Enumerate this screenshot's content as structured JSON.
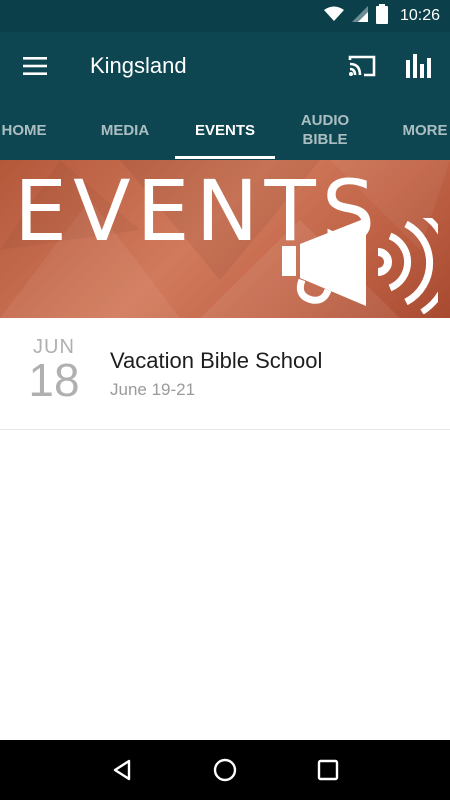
{
  "status_bar": {
    "time": "10:26",
    "icons": [
      "wifi-icon",
      "signal-icon",
      "battery-icon"
    ]
  },
  "app_bar": {
    "title": "Kingsland",
    "icons": [
      "menu-icon",
      "cast-icon",
      "stats-icon"
    ]
  },
  "tabs": [
    {
      "label": "HOME"
    },
    {
      "label": "MEDIA"
    },
    {
      "label": "EVENTS"
    },
    {
      "label": "AUDIO BIBLE"
    },
    {
      "label": "MORE"
    }
  ],
  "active_tab": "EVENTS",
  "banner": {
    "title": "EVENTS",
    "icon": "megaphone-icon"
  },
  "events": [
    {
      "month": "JUN",
      "day": "18",
      "title": "Vacation Bible School",
      "dates": "June 19-21"
    }
  ],
  "nav_bar": {
    "icons": [
      "back-icon",
      "home-icon",
      "recents-icon"
    ]
  },
  "colors": {
    "primary": "#0d4550",
    "banner": "#c26548",
    "text": "#1e1e1e",
    "muted": "#9a9a9a"
  }
}
